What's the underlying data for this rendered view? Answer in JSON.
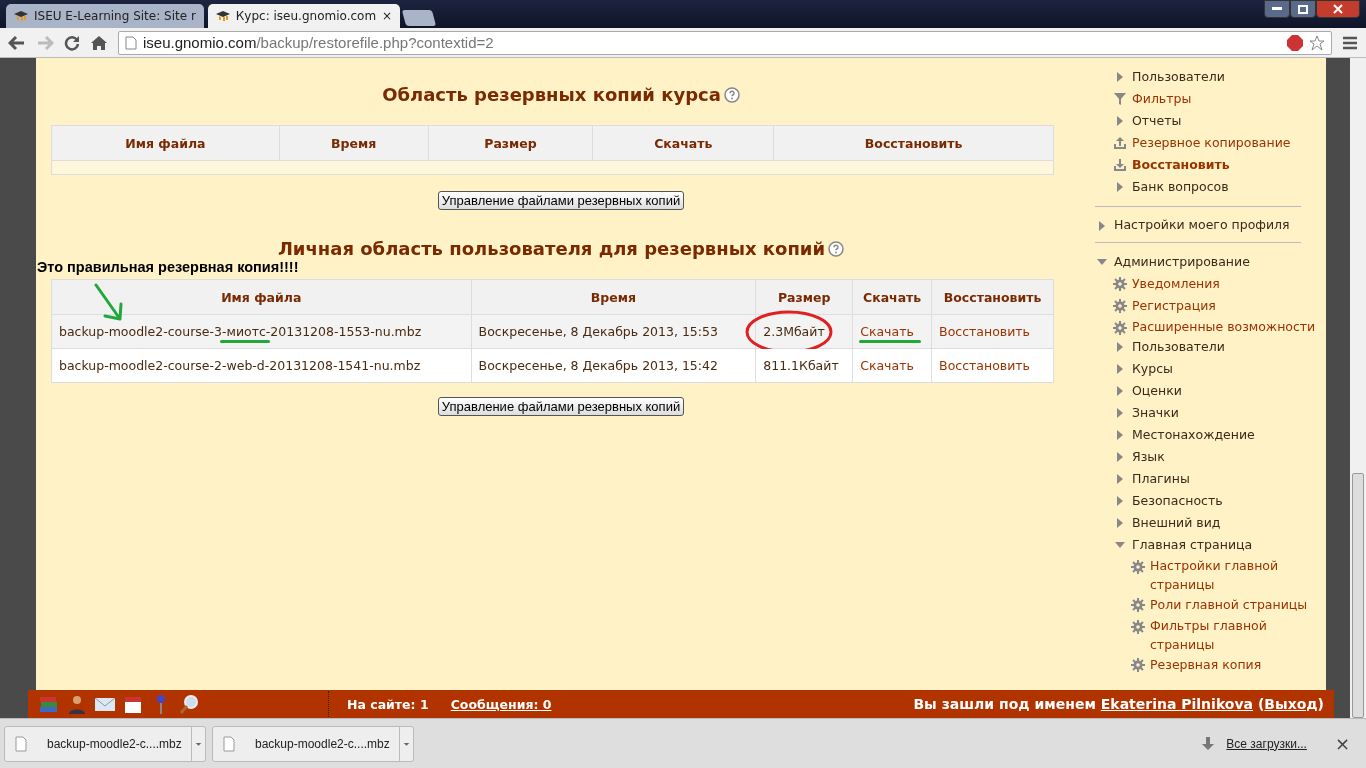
{
  "browser": {
    "tabs": [
      {
        "title": "ISEU E-Learning Site: Site r",
        "selected": false
      },
      {
        "title": "Курс: iseu.gnomio.com",
        "selected": true,
        "close": "×"
      }
    ],
    "url": {
      "host": "iseu.gnomio.com",
      "path": "/backup/restorefile.php?contextid=2"
    }
  },
  "course_backups": {
    "title": "Область резервных копий курса",
    "columns": [
      "Имя файла",
      "Время",
      "Размер",
      "Скачать",
      "Восстановить"
    ],
    "button": "Управление файлами резервных копий"
  },
  "annotation": "Это правильная резервная копия!!!!",
  "user_backups": {
    "title": "Личная область пользователя для резервных копий",
    "columns": [
      "Имя файла",
      "Время",
      "Размер",
      "Скачать",
      "Восстановить"
    ],
    "rows": [
      {
        "file": "backup-moodle2-course-3-миотс-20131208-1553-nu.mbz",
        "time": "Воскресенье, 8 Декабрь 2013, 15:53",
        "size": "2.3Мбайт",
        "download": "Скачать",
        "restore": "Восстановить",
        "annotated": true
      },
      {
        "file": "backup-moodle2-course-2-web-d-20131208-1541-nu.mbz",
        "time": "Воскресенье, 8 Декабрь 2013, 15:42",
        "size": "811.1Кбайт",
        "download": "Скачать",
        "restore": "Восстановить",
        "annotated": false
      }
    ],
    "button": "Управление файлами резервных копий"
  },
  "sidebar": {
    "groups": [
      {
        "items": [
          {
            "label": "Пользователи",
            "kind": "branch"
          },
          {
            "label": "Фильтры",
            "kind": "filter"
          },
          {
            "label": "Отчеты",
            "kind": "branch"
          },
          {
            "label": "Резервное копирование",
            "kind": "backup"
          },
          {
            "label": "Восстановить",
            "kind": "restore",
            "selected": true
          },
          {
            "label": "Банк вопросов",
            "kind": "branch"
          }
        ]
      },
      {
        "items": [
          {
            "label": "Настройки моего профиля",
            "kind": "branch"
          }
        ]
      },
      {
        "items": [
          {
            "label": "Администрирование",
            "kind": "branch",
            "expanded": true,
            "children": [
              {
                "label": "Уведомления",
                "kind": "setting"
              },
              {
                "label": "Регистрация",
                "kind": "setting"
              },
              {
                "label": "Расширенные возможности",
                "kind": "setting"
              },
              {
                "label": "Пользователи",
                "kind": "branch"
              },
              {
                "label": "Курсы",
                "kind": "branch"
              },
              {
                "label": "Оценки",
                "kind": "branch"
              },
              {
                "label": "Значки",
                "kind": "branch"
              },
              {
                "label": "Местонахождение",
                "kind": "branch"
              },
              {
                "label": "Язык",
                "kind": "branch"
              },
              {
                "label": "Плагины",
                "kind": "branch"
              },
              {
                "label": "Безопасность",
                "kind": "branch"
              },
              {
                "label": "Внешний вид",
                "kind": "branch"
              },
              {
                "label": "Главная страница",
                "kind": "branch",
                "expanded": true,
                "children": [
                  {
                    "label": "Настройки главной страницы",
                    "kind": "setting"
                  },
                  {
                    "label": "Роли главной страницы",
                    "kind": "setting"
                  },
                  {
                    "label": "Фильтры главной страницы",
                    "kind": "setting"
                  },
                  {
                    "label": "Резервная копия",
                    "kind": "setting"
                  }
                ]
              }
            ]
          }
        ]
      }
    ]
  },
  "footer": {
    "online": "На сайте: 1",
    "messages": "Сообщения: 0",
    "login": {
      "prefix": "Вы зашли под именем",
      "user": "Ekaterina Pilnikova",
      "open": "(",
      "logout": "Выход",
      "close": ")"
    }
  },
  "downloads": {
    "items": [
      "backup-moodle2-c....mbz",
      "backup-moodle2-c....mbz"
    ],
    "all": "Все загрузки...",
    "close": "×"
  }
}
